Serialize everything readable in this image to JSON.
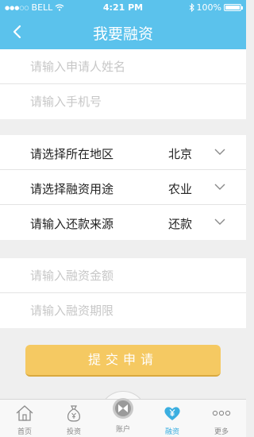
{
  "status_bar": {
    "carrier": "BELL",
    "time": "4:21 PM",
    "battery": "100%"
  },
  "header": {
    "title": "我要融资"
  },
  "inputs_top": [
    {
      "placeholder": "请输入申请人姓名"
    },
    {
      "placeholder": "请输入手机号"
    }
  ],
  "selects": [
    {
      "label": "请选择所在地区",
      "value": "北京"
    },
    {
      "label": "请选择融资用途",
      "value": "农业"
    },
    {
      "label": "请输入还款来源",
      "value": "还款"
    }
  ],
  "inputs_bottom": [
    {
      "placeholder": "请输入融资金额"
    },
    {
      "placeholder": "请输入融资期限"
    }
  ],
  "submit_label": "提交申请",
  "tabs": [
    {
      "label": "首页",
      "icon": "home-icon"
    },
    {
      "label": "投资",
      "icon": "money-bag-icon"
    },
    {
      "label": "账户",
      "icon": "account-icon"
    },
    {
      "label": "融资",
      "icon": "heart-yen-icon",
      "active": true
    },
    {
      "label": "更多",
      "icon": "more-icon"
    }
  ],
  "colors": {
    "header": "#5bc2ec",
    "submit": "#f5c962",
    "active_tab": "#3aaee0"
  }
}
